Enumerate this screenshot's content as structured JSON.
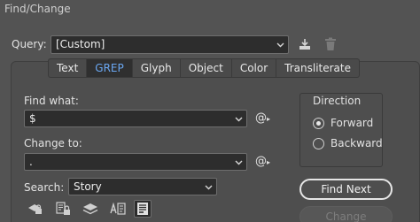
{
  "window": {
    "title": "Find/Change"
  },
  "query": {
    "label": "Query:",
    "value": "[Custom]"
  },
  "tabs": [
    {
      "label": "Text",
      "active": false
    },
    {
      "label": "GREP",
      "active": true
    },
    {
      "label": "Glyph",
      "active": false
    },
    {
      "label": "Object",
      "active": false
    },
    {
      "label": "Color",
      "active": false
    },
    {
      "label": "Transliterate",
      "active": false
    }
  ],
  "find": {
    "label": "Find what:",
    "value": "$"
  },
  "change": {
    "label": "Change to:",
    "value": "."
  },
  "search": {
    "label": "Search:",
    "value": "Story"
  },
  "direction": {
    "label": "Direction",
    "forward": "Forward",
    "backward": "Backward",
    "selected": "Forward"
  },
  "buttons": {
    "find_next": "Find Next",
    "change": "Change"
  },
  "special_char_symbol": "@",
  "colors": {
    "accent": "#6aa7f2",
    "background": "#535353",
    "field": "#2d2d2d"
  }
}
